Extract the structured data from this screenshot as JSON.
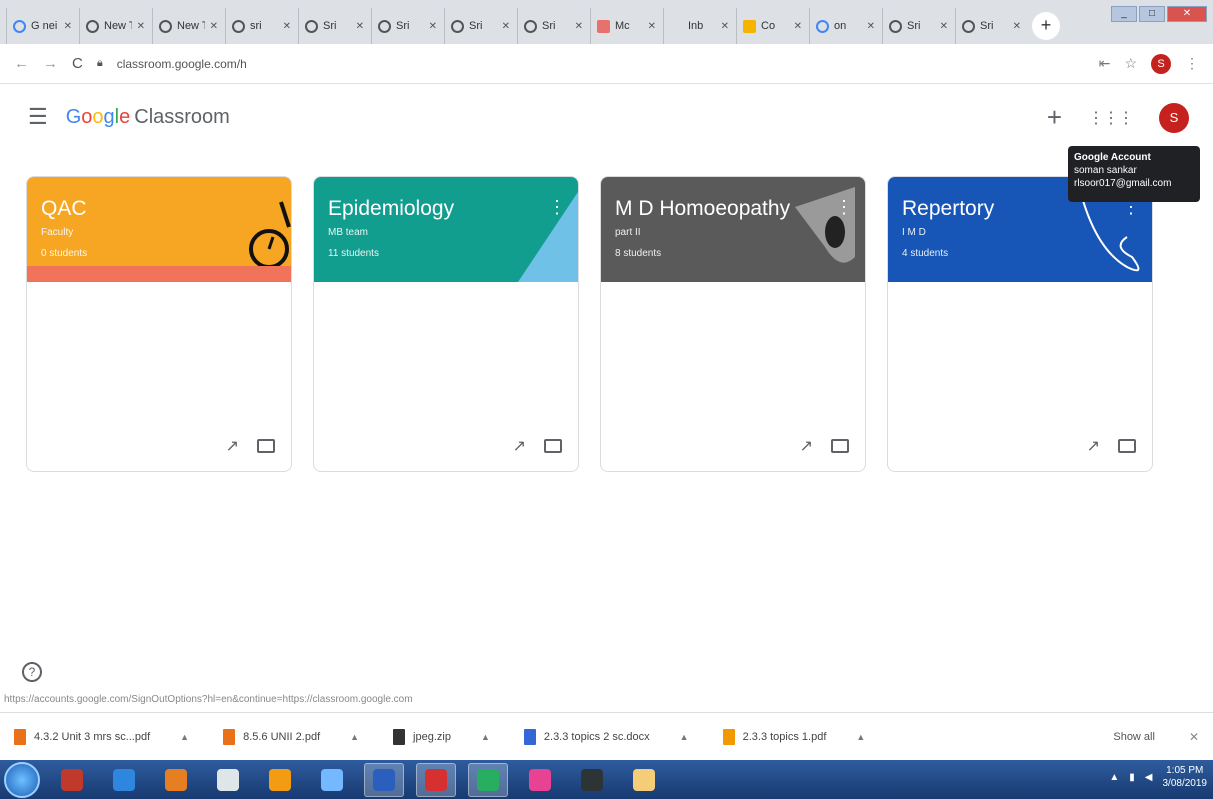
{
  "browser": {
    "tabs": [
      {
        "label": "G nei",
        "icon": "g"
      },
      {
        "label": "New Ta",
        "icon": "c"
      },
      {
        "label": "New Ta",
        "icon": "c"
      },
      {
        "label": "sri",
        "icon": "c"
      },
      {
        "label": "Sri",
        "icon": "c"
      },
      {
        "label": "Sri",
        "icon": "c"
      },
      {
        "label": "Sri",
        "icon": "c"
      },
      {
        "label": "Sri",
        "icon": "c"
      },
      {
        "label": "Mc",
        "icon": "r"
      },
      {
        "label": "Inb",
        "icon": "m"
      },
      {
        "label": "Co",
        "icon": "y"
      },
      {
        "label": "on",
        "icon": "g"
      },
      {
        "label": "Sri",
        "icon": "c"
      },
      {
        "label": "Sri",
        "icon": "c"
      }
    ],
    "new_tab": "+",
    "url": "classroom.google.com/h",
    "profile_initial": "S"
  },
  "app": {
    "logo_google": [
      "G",
      "o",
      "o",
      "g",
      "l",
      "e"
    ],
    "logo_product": "Classroom",
    "add_glyph": "+",
    "apps_glyph": "⋮⋮⋮",
    "avatar_initial": "S"
  },
  "tooltip": {
    "title": "Google Account",
    "name": "soman sankar",
    "email": "rlsoor017@gmail.com"
  },
  "cards": [
    {
      "title": "QAC",
      "subtitle": "Faculty",
      "count": "0 students",
      "color": "#f6a623",
      "accent": "#f0735a"
    },
    {
      "title": "Epidemiology",
      "subtitle": "MB team",
      "count": "11 students",
      "color": "#129e8e",
      "accent": "#6fc1e8"
    },
    {
      "title": "M D Homoeopathy",
      "subtitle": "part II",
      "count": "8 students",
      "color": "#5a5a5a",
      "accent": "#9a9a9a"
    },
    {
      "title": "Repertory",
      "subtitle": "I M D",
      "count": "4 students",
      "color": "#1756b6",
      "accent": "#ffffff"
    }
  ],
  "status_url": "https://accounts.google.com/SignOutOptions?hl=en&continue=https://classroom.google.com",
  "downloads": [
    {
      "name": "4.3.2 Unit 3 mrs sc...pdf",
      "icon": "pdf"
    },
    {
      "name": "8.5.6 UNII 2.pdf",
      "icon": "pdf"
    },
    {
      "name": "jpeg.zip",
      "icon": "zip"
    },
    {
      "name": "2.3.3 topics 2 sc.docx",
      "icon": "doc"
    },
    {
      "name": "2.3.3 topics 1.pdf",
      "icon": "cone"
    }
  ],
  "downloads_show_all": "Show all",
  "taskbar": {
    "apps": [
      {
        "name": "acrobat",
        "color": "#c0392b"
      },
      {
        "name": "ie",
        "color": "#2e86de"
      },
      {
        "name": "media",
        "color": "#e67e22"
      },
      {
        "name": "search",
        "color": "#dfe6e9"
      },
      {
        "name": "vlc",
        "color": "#f39c12"
      },
      {
        "name": "network",
        "color": "#74b9ff"
      },
      {
        "name": "word",
        "color": "#2a5fbd"
      },
      {
        "name": "opera",
        "color": "#d63031"
      },
      {
        "name": "chrome",
        "color": "#27ae60"
      },
      {
        "name": "paint",
        "color": "#e84393"
      },
      {
        "name": "calculator",
        "color": "#2d3436"
      },
      {
        "name": "folder",
        "color": "#f5cd79"
      }
    ],
    "time": "1:05 PM",
    "date": "3/08/2019"
  }
}
